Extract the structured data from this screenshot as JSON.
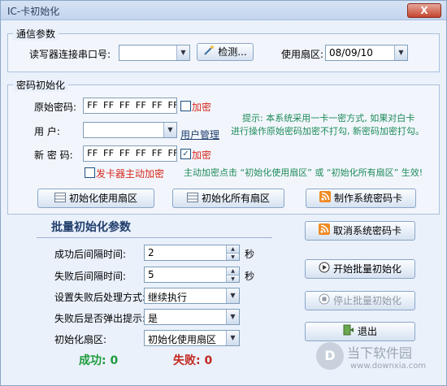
{
  "window": {
    "title": "IC-卡初始化",
    "close_glyph": "X"
  },
  "comm": {
    "title": "通信参数",
    "port_label": "读写器连接串口号:",
    "port_value": "",
    "detect_button": "检测...",
    "sector_label": "使用扇区:",
    "sector_value": "08/09/10"
  },
  "pwd": {
    "title": "密码初始化",
    "orig_label": "原始密码:",
    "orig_value": "FF FF FF FF FF FF",
    "orig_encrypt": "加密",
    "user_label": "用    户:",
    "user_value": "",
    "user_manage": "用户管理",
    "new_label": "新 密 码:",
    "new_value": "FF FF FF FF FF FF",
    "new_encrypt": "加密",
    "reader_encrypt": "发卡器主动加密",
    "tip_line1": "提示: 本系统采用一卡一密方式, 如果对白卡",
    "tip_line2": "进行操作原始密码加密不打勾, 新密码加密打勾。",
    "note": "主动加密点击 “初始化使用扇区” 或 “初始化所有扇区” 生效!",
    "init_used_btn": "初始化使用扇区",
    "init_all_btn": "初始化所有扇区"
  },
  "batch": {
    "title": "批量初始化参数",
    "success_interval_label": "成功后间隔时间:",
    "success_interval_value": "2",
    "success_unit": "秒",
    "fail_interval_label": "失败后间隔时间:",
    "fail_interval_value": "5",
    "fail_unit": "秒",
    "fail_mode_label": "设置失败后处理方式:",
    "fail_mode_value": "继续执行",
    "popup_label": "失败后是否弹出提示:",
    "popup_value": "是",
    "sector_label": "初始化扇区:",
    "sector_value": "初始化使用扇区",
    "success_text": "成功: 0",
    "fail_text": "失败: 0"
  },
  "actions": {
    "make_card": "制作系统密码卡",
    "cancel_card": "取消系统密码卡",
    "start_batch": "开始批量初始化",
    "stop_batch": "停止批量初始化",
    "exit": "退出"
  },
  "watermark": {
    "main": "当下软件园",
    "sub": "www.downxia.com",
    "logo": "D"
  }
}
